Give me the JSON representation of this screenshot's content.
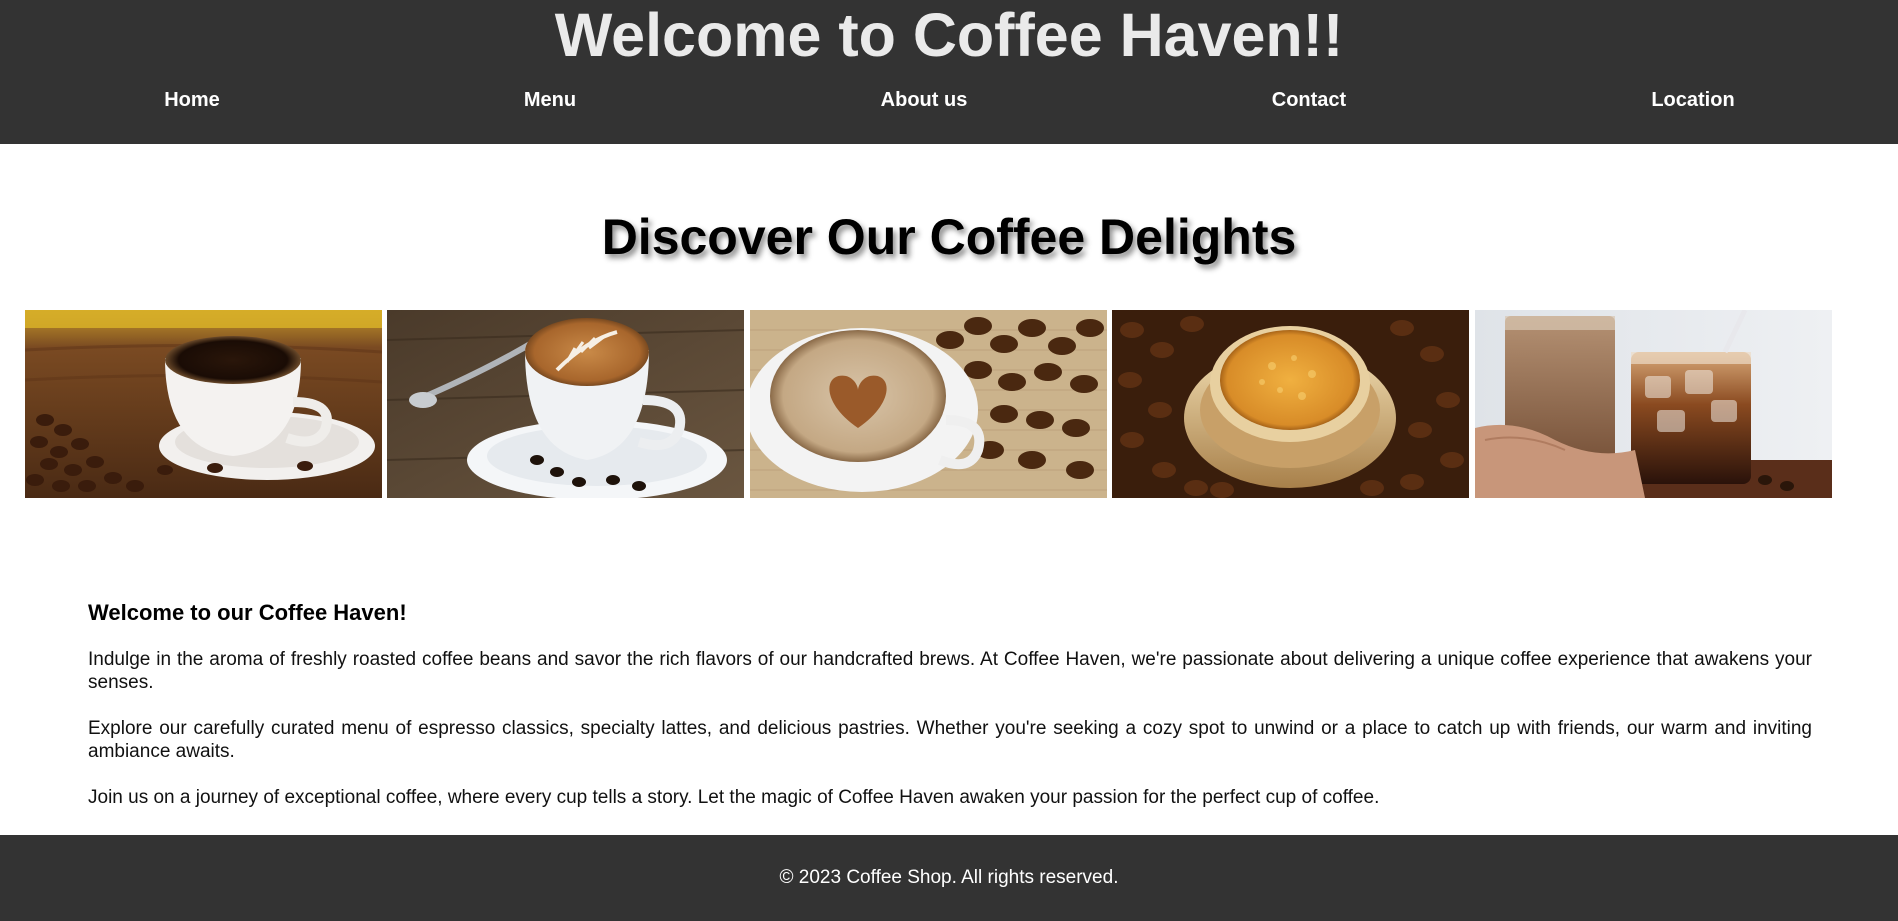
{
  "header": {
    "title": "Welcome to Coffee Haven!!",
    "nav": [
      {
        "label": "Home"
      },
      {
        "label": "Menu"
      },
      {
        "label": "About us"
      },
      {
        "label": "Contact"
      },
      {
        "label": "Location"
      }
    ]
  },
  "main": {
    "heading": "Discover Our Coffee Delights",
    "gallery": [
      {
        "image": "coffee-cup-with-beans-photo"
      },
      {
        "image": "latte-art-cup-photo"
      },
      {
        "image": "heart-cappuccino-photo"
      },
      {
        "image": "filter-coffee-photo"
      },
      {
        "image": "iced-coffee-glasses-photo"
      }
    ],
    "intro": {
      "heading": "Welcome to our Coffee Haven!",
      "paragraphs": [
        "Indulge in the aroma of freshly roasted coffee beans and savor the rich flavors of our handcrafted brews. At Coffee Haven, we're passionate about delivering a unique coffee experience that awakens your senses.",
        "Explore our carefully curated menu of espresso classics, specialty lattes, and delicious pastries. Whether you're seeking a cozy spot to unwind or a place to catch up with friends, our warm and inviting ambiance awaits.",
        "Join us on a journey of exceptional coffee, where every cup tells a story. Let the magic of Coffee Haven awaken your passion for the perfect cup of coffee."
      ]
    }
  },
  "footer": {
    "text": "© 2023 Coffee Shop. All rights reserved."
  },
  "colors": {
    "header_bg": "#333333",
    "footer_bg": "#333333",
    "title_text": "#eaeaea",
    "nav_text": "#ffffff"
  }
}
